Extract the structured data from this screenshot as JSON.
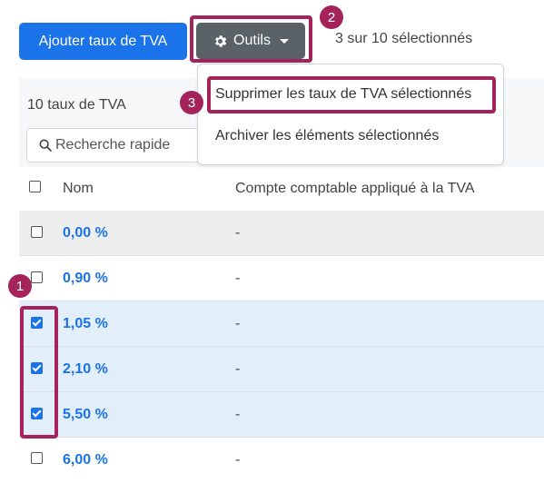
{
  "toolbar": {
    "add_label": "Ajouter taux de TVA",
    "tools_label": "Outils",
    "selection_status": "3 sur 10 sélectionnés"
  },
  "tools_menu": {
    "items": [
      {
        "label": "Supprimer les taux de TVA sélectionnés"
      },
      {
        "label": "Archiver les éléments sélectionnés"
      }
    ]
  },
  "list": {
    "count_label": "10 taux de TVA",
    "search_placeholder": "Recherche rapide"
  },
  "table": {
    "headers": {
      "name": "Nom",
      "account": "Compte comptable appliqué à la TVA"
    },
    "rows": [
      {
        "rate": "0,00 %",
        "account": "-",
        "checked": false
      },
      {
        "rate": "0,90 %",
        "account": "-",
        "checked": false
      },
      {
        "rate": "1,05 %",
        "account": "-",
        "checked": true
      },
      {
        "rate": "2,10 %",
        "account": "-",
        "checked": true
      },
      {
        "rate": "5,50 %",
        "account": "-",
        "checked": true
      },
      {
        "rate": "6,00 %",
        "account": "-",
        "checked": false
      }
    ]
  },
  "annotations": {
    "step1": "1",
    "step2": "2",
    "step3": "3"
  },
  "colors": {
    "primary": "#1a73e8",
    "highlight": "#a3235a",
    "tools_button": "#5a6268",
    "selected_row": "#e3eefb"
  }
}
